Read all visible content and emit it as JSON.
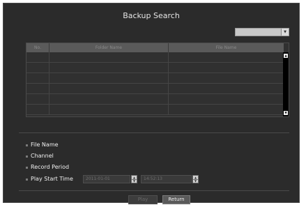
{
  "dialog": {
    "title": "Backup Search"
  },
  "device_select": {
    "value": ""
  },
  "table": {
    "headers": [
      "No.",
      "Folder Name",
      "File Name"
    ],
    "rows": [
      [
        "",
        "",
        ""
      ],
      [
        "",
        "",
        ""
      ],
      [
        "",
        "",
        ""
      ],
      [
        "",
        "",
        ""
      ],
      [
        "",
        "",
        ""
      ],
      [
        "",
        "",
        ""
      ]
    ]
  },
  "details": {
    "file_name_label": "File Name",
    "channel_label": "Channel",
    "record_period_label": "Record Period",
    "play_start_time_label": "Play Start Time",
    "play_start_date": "2011-01-01",
    "play_start_clock": "14:52:13"
  },
  "buttons": {
    "play": "Play",
    "return": "Return"
  }
}
